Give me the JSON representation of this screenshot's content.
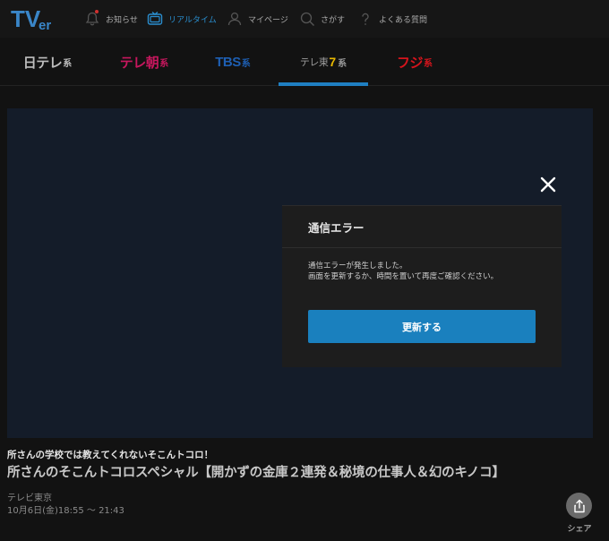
{
  "header": {
    "logo_text": "TVer",
    "nav": [
      {
        "label": "お知らせ",
        "icon": "bell-icon",
        "badge": true
      },
      {
        "label": "リアルタイム",
        "icon": "tv-icon",
        "active": true
      },
      {
        "label": "マイページ",
        "icon": "user-icon"
      },
      {
        "label": "さがす",
        "icon": "search-icon"
      },
      {
        "label": "よくある質問",
        "icon": "question-icon"
      }
    ]
  },
  "tabs": [
    {
      "name": "日テレ",
      "suffix": "系",
      "color": "#bdbdbd"
    },
    {
      "name": "テレ朝",
      "suffix": "系",
      "color": "#c7175e"
    },
    {
      "name": "TBS",
      "suffix": "系",
      "color": "#1e5fb3"
    },
    {
      "name": "テレ東",
      "seven": "7",
      "suffix": "系",
      "color": "#9a9a9a",
      "active": true
    },
    {
      "name": "フジ",
      "suffix": "系",
      "color": "#d6141c"
    }
  ],
  "modal": {
    "title": "通信エラー",
    "message_line1": "通信エラーが発生しました。",
    "message_line2": "画面を更新するか、時間を置いて再度ご確認ください。",
    "button_label": "更新する"
  },
  "program": {
    "subtitle": "所さんの学校では教えてくれないそこんトコロ！",
    "title": "所さんのそこんトコロスペシャル【開かずの金庫２連発＆秘境の仕事人＆幻のキノコ】",
    "channel": "テレビ東京",
    "airtime": "10月6日(金)18:55 〜 21:43"
  },
  "share_label": "シェア",
  "colors": {
    "accent": "#1a80be",
    "active_nav": "#2a8fd0",
    "background": "#121212",
    "player_background": "#141c29"
  }
}
